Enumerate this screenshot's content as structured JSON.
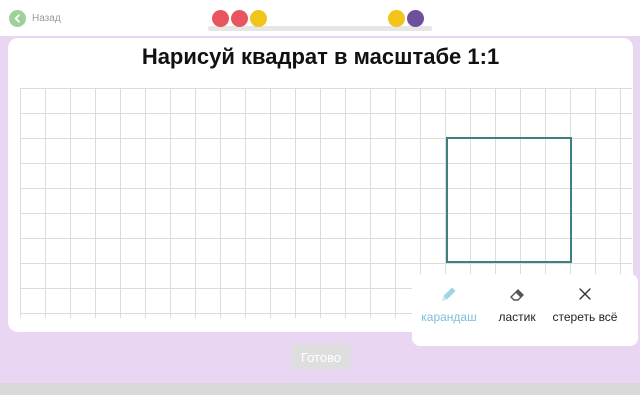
{
  "nav": {
    "back_label": "Назад",
    "back_color": "#9fd09a"
  },
  "progress": {
    "left_dots": [
      "#e8555f",
      "#e8555f",
      "#f2c318"
    ],
    "right_dots": [
      "#f2c318",
      "#6d4f9c"
    ]
  },
  "task": {
    "title": "Нарисуй квадрат в масштабе 1:1"
  },
  "tools": [
    {
      "label": "карандаш",
      "icon": "pencil-icon",
      "active": true
    },
    {
      "label": "ластик",
      "icon": "eraser-icon",
      "active": false
    },
    {
      "label": "стереть всё",
      "icon": "close-icon",
      "active": false
    }
  ],
  "actions": {
    "done_label": "Готово"
  },
  "colors": {
    "background": "#e9d6f3",
    "square_stroke": "#3f7f7f",
    "active_tool": "#7cc0d8"
  }
}
